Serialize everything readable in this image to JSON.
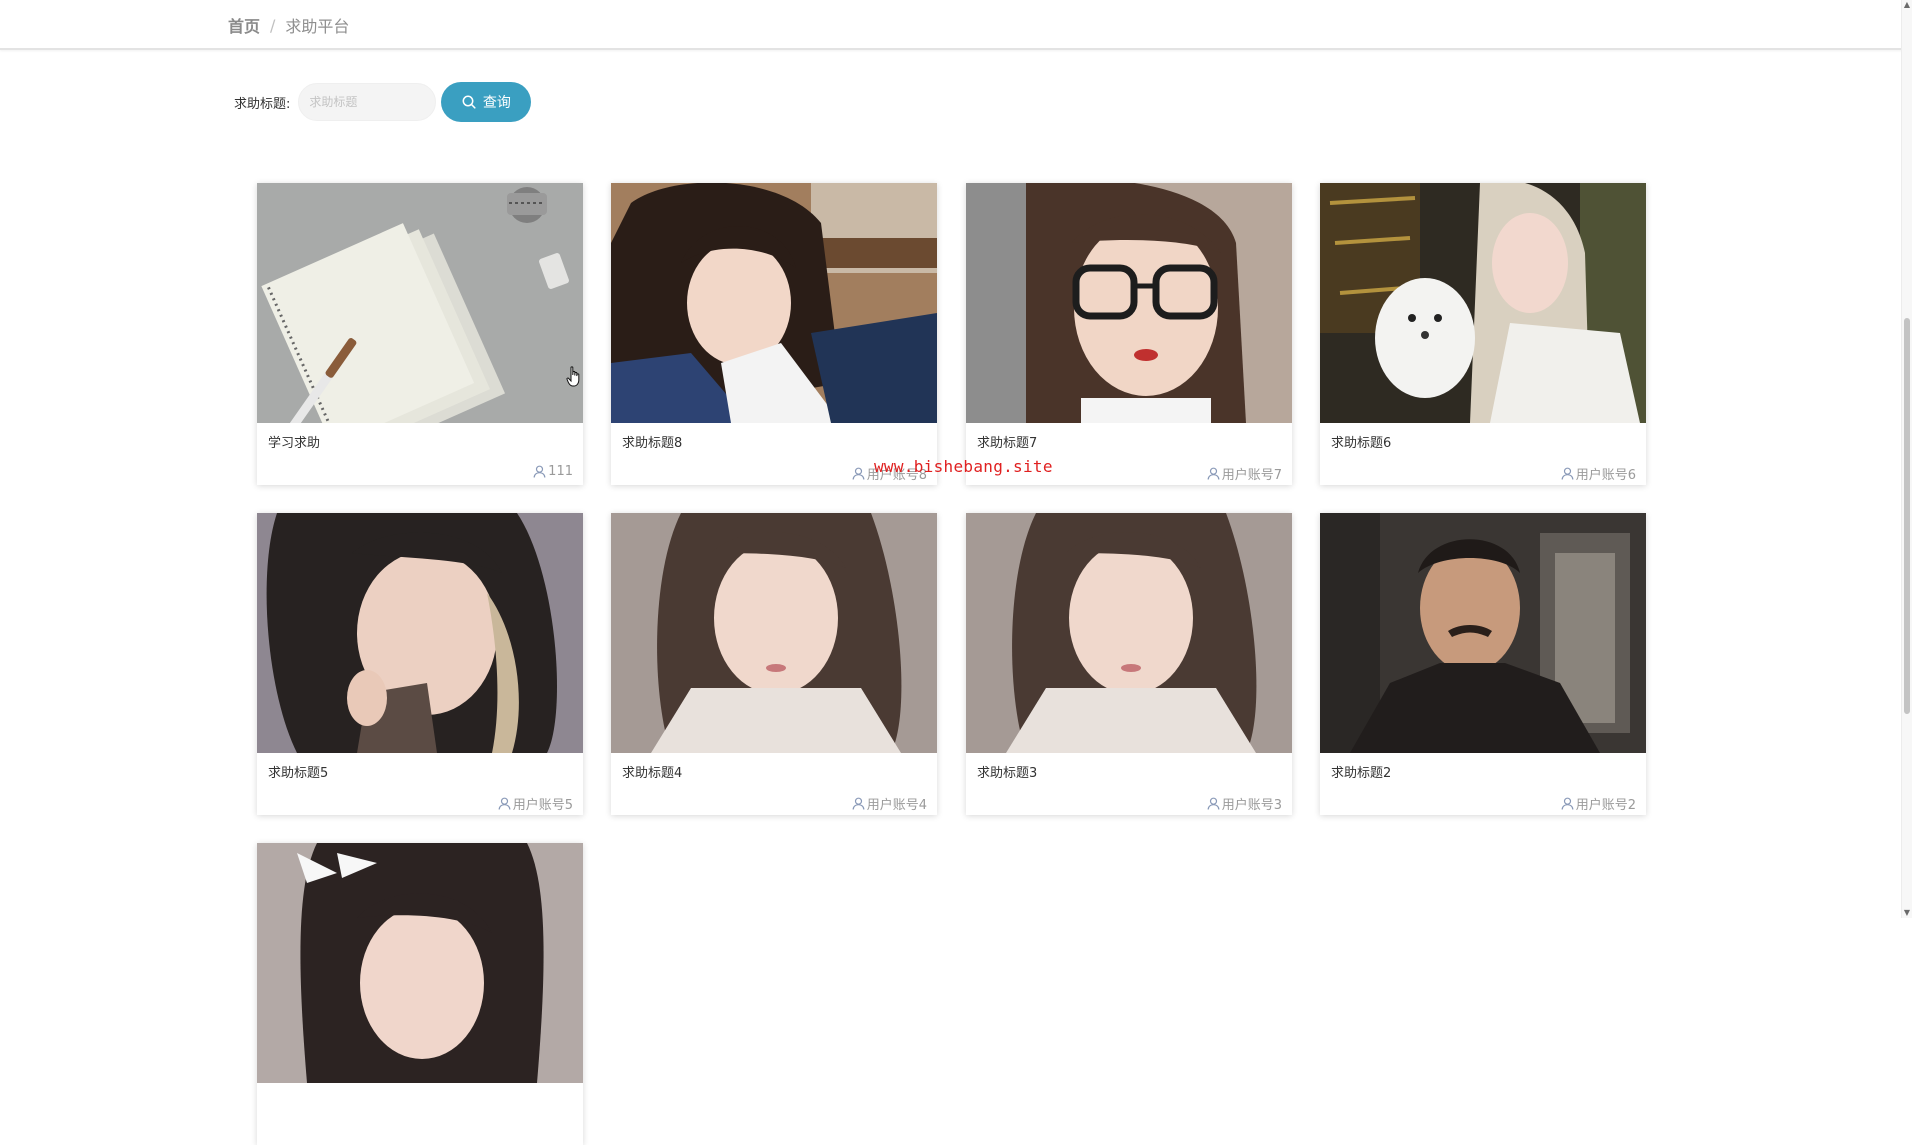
{
  "breadcrumb": {
    "home": "首页",
    "separator": "/",
    "current": "求助平台"
  },
  "search": {
    "label": "求助标题:",
    "placeholder": "求助标题",
    "value": "",
    "button_label": "查询",
    "button_color": "#3a9fc1"
  },
  "cards": [
    {
      "title": "学习求助",
      "user": "111",
      "image": "photo-notebooks"
    },
    {
      "title": "求助标题8",
      "user": "用户账号8",
      "image": "photo-girl-resting"
    },
    {
      "title": "求助标题7",
      "user": "用户账号7",
      "image": "photo-girl-glasses"
    },
    {
      "title": "求助标题6",
      "user": "用户账号6",
      "image": "photo-girl-dog"
    },
    {
      "title": "求助标题5",
      "user": "用户账号5",
      "image": "photo-girl-wink"
    },
    {
      "title": "求助标题4",
      "user": "用户账号4",
      "image": "photo-girl-sweater"
    },
    {
      "title": "求助标题3",
      "user": "用户账号3",
      "image": "photo-girl-sweater"
    },
    {
      "title": "求助标题2",
      "user": "用户账号2",
      "image": "photo-man-dark"
    },
    {
      "title": "",
      "user": "",
      "image": "photo-girl-bow"
    }
  ],
  "icons": {
    "search": "search-icon",
    "user": "user-icon"
  },
  "watermark": "www.bishebang.site",
  "colors": {
    "accent": "#3a9fc1",
    "watermark": "#e02020"
  }
}
